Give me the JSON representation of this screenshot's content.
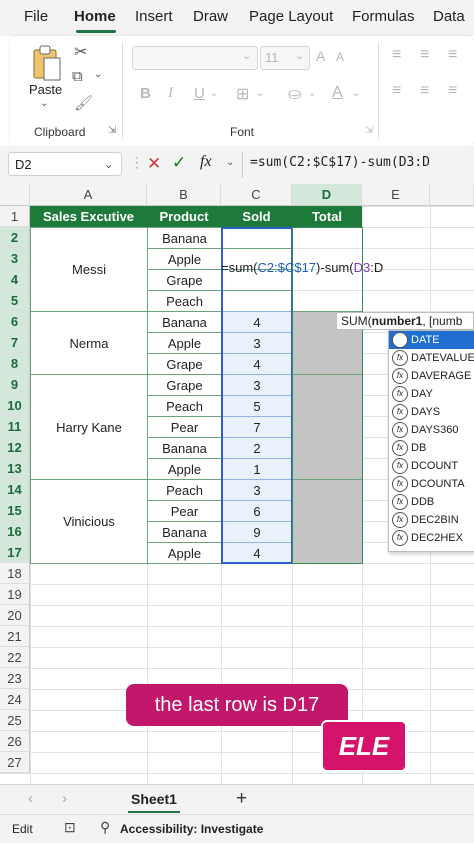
{
  "menu": {
    "tabs": [
      "File",
      "Home",
      "Insert",
      "Draw",
      "Page Layout",
      "Formulas",
      "Data"
    ],
    "active": "Home"
  },
  "ribbon": {
    "paste_label": "Paste",
    "clipboard_label": "Clipboard",
    "font_label": "Font",
    "font_size": "11",
    "bold": "B",
    "italic": "I",
    "underline": "U",
    "font_color_glyph": "A"
  },
  "formula_bar": {
    "name_box": "D2",
    "fx": "fx",
    "formula": "=sum(C2:$C$17)-sum(D3:D"
  },
  "columns": [
    "A",
    "B",
    "C",
    "D",
    "E"
  ],
  "rows": [
    "1",
    "2",
    "3",
    "4",
    "5",
    "6",
    "7",
    "8",
    "9",
    "10",
    "11",
    "12",
    "13",
    "14",
    "15",
    "16",
    "17",
    "18",
    "19",
    "20",
    "21",
    "22",
    "23",
    "24",
    "25",
    "26",
    "27"
  ],
  "table": {
    "headers": [
      "Sales Excutive",
      "Product",
      "Sold",
      "Total"
    ],
    "groups": [
      {
        "name": "Messi",
        "products": [
          "Banana",
          "Apple",
          "Grape",
          "Peach"
        ],
        "sold": [
          "",
          "",
          "",
          ""
        ]
      },
      {
        "name": "Nerma",
        "products": [
          "Banana",
          "Apple",
          "Grape"
        ],
        "sold": [
          "4",
          "3",
          "4"
        ]
      },
      {
        "name": "Harry Kane",
        "products": [
          "Grape",
          "Peach",
          "Pear",
          "Banana",
          "Apple"
        ],
        "sold": [
          "3",
          "5",
          "7",
          "2",
          "1"
        ]
      },
      {
        "name": "Vinicious",
        "products": [
          "Peach",
          "Pear",
          "Banana",
          "Apple"
        ],
        "sold": [
          "3",
          "6",
          "9",
          "4"
        ]
      }
    ]
  },
  "editing_cell": {
    "text_prefix": "=sum(",
    "ref1": "C2:$C$17",
    "text_mid": ")-sum(",
    "ref2": "D3",
    "text_suffix": ":D"
  },
  "tooltip": {
    "fn": "SUM(",
    "arg": "number1",
    "rest": ", [numb"
  },
  "autocomplete": [
    "DATE",
    "DATEVALUE",
    "DAVERAGE",
    "DAY",
    "DAYS",
    "DAYS360",
    "DB",
    "DCOUNT",
    "DCOUNTA",
    "DDB",
    "DEC2BIN",
    "DEC2HEX"
  ],
  "sheet": {
    "tab": "Sheet1",
    "add": "+"
  },
  "status": {
    "mode": "Edit",
    "accessibility": "Accessibility: Investigate"
  },
  "caption": "the last row is D17",
  "badge": "ELE",
  "colors": {
    "excel_green": "#217346",
    "header_green": "#1d7a3a",
    "caption": "#c1186c",
    "badge": "#d6136a",
    "ref_blue": "#1f5fb8",
    "ref_purple": "#7a3bb0"
  }
}
